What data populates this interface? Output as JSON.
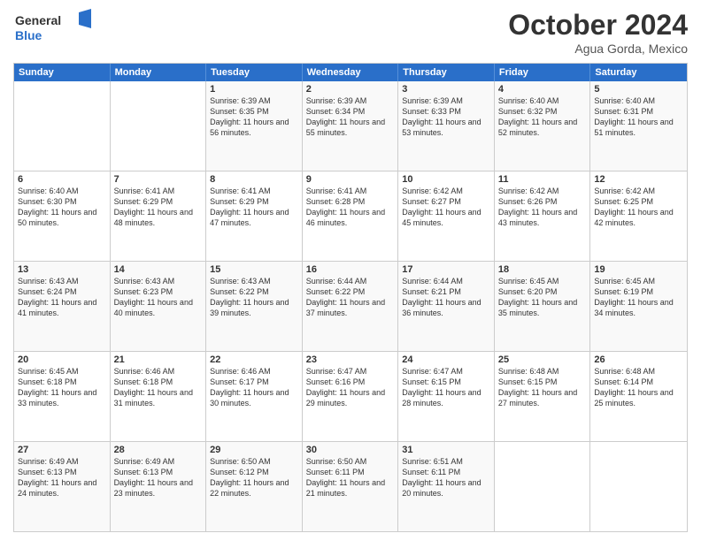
{
  "logo": {
    "line1": "General",
    "line2": "Blue"
  },
  "title": "October 2024",
  "location": "Agua Gorda, Mexico",
  "days_of_week": [
    "Sunday",
    "Monday",
    "Tuesday",
    "Wednesday",
    "Thursday",
    "Friday",
    "Saturday"
  ],
  "weeks": [
    [
      {
        "day": "",
        "sunrise": "",
        "sunset": "",
        "daylight": ""
      },
      {
        "day": "",
        "sunrise": "",
        "sunset": "",
        "daylight": ""
      },
      {
        "day": "1",
        "sunrise": "Sunrise: 6:39 AM",
        "sunset": "Sunset: 6:35 PM",
        "daylight": "Daylight: 11 hours and 56 minutes."
      },
      {
        "day": "2",
        "sunrise": "Sunrise: 6:39 AM",
        "sunset": "Sunset: 6:34 PM",
        "daylight": "Daylight: 11 hours and 55 minutes."
      },
      {
        "day": "3",
        "sunrise": "Sunrise: 6:39 AM",
        "sunset": "Sunset: 6:33 PM",
        "daylight": "Daylight: 11 hours and 53 minutes."
      },
      {
        "day": "4",
        "sunrise": "Sunrise: 6:40 AM",
        "sunset": "Sunset: 6:32 PM",
        "daylight": "Daylight: 11 hours and 52 minutes."
      },
      {
        "day": "5",
        "sunrise": "Sunrise: 6:40 AM",
        "sunset": "Sunset: 6:31 PM",
        "daylight": "Daylight: 11 hours and 51 minutes."
      }
    ],
    [
      {
        "day": "6",
        "sunrise": "Sunrise: 6:40 AM",
        "sunset": "Sunset: 6:30 PM",
        "daylight": "Daylight: 11 hours and 50 minutes."
      },
      {
        "day": "7",
        "sunrise": "Sunrise: 6:41 AM",
        "sunset": "Sunset: 6:29 PM",
        "daylight": "Daylight: 11 hours and 48 minutes."
      },
      {
        "day": "8",
        "sunrise": "Sunrise: 6:41 AM",
        "sunset": "Sunset: 6:29 PM",
        "daylight": "Daylight: 11 hours and 47 minutes."
      },
      {
        "day": "9",
        "sunrise": "Sunrise: 6:41 AM",
        "sunset": "Sunset: 6:28 PM",
        "daylight": "Daylight: 11 hours and 46 minutes."
      },
      {
        "day": "10",
        "sunrise": "Sunrise: 6:42 AM",
        "sunset": "Sunset: 6:27 PM",
        "daylight": "Daylight: 11 hours and 45 minutes."
      },
      {
        "day": "11",
        "sunrise": "Sunrise: 6:42 AM",
        "sunset": "Sunset: 6:26 PM",
        "daylight": "Daylight: 11 hours and 43 minutes."
      },
      {
        "day": "12",
        "sunrise": "Sunrise: 6:42 AM",
        "sunset": "Sunset: 6:25 PM",
        "daylight": "Daylight: 11 hours and 42 minutes."
      }
    ],
    [
      {
        "day": "13",
        "sunrise": "Sunrise: 6:43 AM",
        "sunset": "Sunset: 6:24 PM",
        "daylight": "Daylight: 11 hours and 41 minutes."
      },
      {
        "day": "14",
        "sunrise": "Sunrise: 6:43 AM",
        "sunset": "Sunset: 6:23 PM",
        "daylight": "Daylight: 11 hours and 40 minutes."
      },
      {
        "day": "15",
        "sunrise": "Sunrise: 6:43 AM",
        "sunset": "Sunset: 6:22 PM",
        "daylight": "Daylight: 11 hours and 39 minutes."
      },
      {
        "day": "16",
        "sunrise": "Sunrise: 6:44 AM",
        "sunset": "Sunset: 6:22 PM",
        "daylight": "Daylight: 11 hours and 37 minutes."
      },
      {
        "day": "17",
        "sunrise": "Sunrise: 6:44 AM",
        "sunset": "Sunset: 6:21 PM",
        "daylight": "Daylight: 11 hours and 36 minutes."
      },
      {
        "day": "18",
        "sunrise": "Sunrise: 6:45 AM",
        "sunset": "Sunset: 6:20 PM",
        "daylight": "Daylight: 11 hours and 35 minutes."
      },
      {
        "day": "19",
        "sunrise": "Sunrise: 6:45 AM",
        "sunset": "Sunset: 6:19 PM",
        "daylight": "Daylight: 11 hours and 34 minutes."
      }
    ],
    [
      {
        "day": "20",
        "sunrise": "Sunrise: 6:45 AM",
        "sunset": "Sunset: 6:18 PM",
        "daylight": "Daylight: 11 hours and 33 minutes."
      },
      {
        "day": "21",
        "sunrise": "Sunrise: 6:46 AM",
        "sunset": "Sunset: 6:18 PM",
        "daylight": "Daylight: 11 hours and 31 minutes."
      },
      {
        "day": "22",
        "sunrise": "Sunrise: 6:46 AM",
        "sunset": "Sunset: 6:17 PM",
        "daylight": "Daylight: 11 hours and 30 minutes."
      },
      {
        "day": "23",
        "sunrise": "Sunrise: 6:47 AM",
        "sunset": "Sunset: 6:16 PM",
        "daylight": "Daylight: 11 hours and 29 minutes."
      },
      {
        "day": "24",
        "sunrise": "Sunrise: 6:47 AM",
        "sunset": "Sunset: 6:15 PM",
        "daylight": "Daylight: 11 hours and 28 minutes."
      },
      {
        "day": "25",
        "sunrise": "Sunrise: 6:48 AM",
        "sunset": "Sunset: 6:15 PM",
        "daylight": "Daylight: 11 hours and 27 minutes."
      },
      {
        "day": "26",
        "sunrise": "Sunrise: 6:48 AM",
        "sunset": "Sunset: 6:14 PM",
        "daylight": "Daylight: 11 hours and 25 minutes."
      }
    ],
    [
      {
        "day": "27",
        "sunrise": "Sunrise: 6:49 AM",
        "sunset": "Sunset: 6:13 PM",
        "daylight": "Daylight: 11 hours and 24 minutes."
      },
      {
        "day": "28",
        "sunrise": "Sunrise: 6:49 AM",
        "sunset": "Sunset: 6:13 PM",
        "daylight": "Daylight: 11 hours and 23 minutes."
      },
      {
        "day": "29",
        "sunrise": "Sunrise: 6:50 AM",
        "sunset": "Sunset: 6:12 PM",
        "daylight": "Daylight: 11 hours and 22 minutes."
      },
      {
        "day": "30",
        "sunrise": "Sunrise: 6:50 AM",
        "sunset": "Sunset: 6:11 PM",
        "daylight": "Daylight: 11 hours and 21 minutes."
      },
      {
        "day": "31",
        "sunrise": "Sunrise: 6:51 AM",
        "sunset": "Sunset: 6:11 PM",
        "daylight": "Daylight: 11 hours and 20 minutes."
      },
      {
        "day": "",
        "sunrise": "",
        "sunset": "",
        "daylight": ""
      },
      {
        "day": "",
        "sunrise": "",
        "sunset": "",
        "daylight": ""
      }
    ]
  ]
}
